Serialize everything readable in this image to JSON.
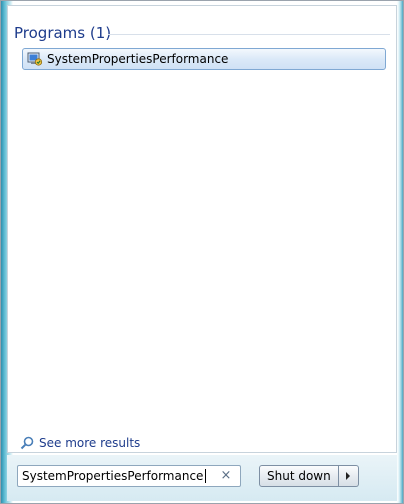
{
  "results": {
    "section_title": "Programs (1)",
    "items": [
      {
        "label": "SystemPropertiesPerformance",
        "icon": "system-properties-icon"
      }
    ]
  },
  "see_more": {
    "label": "See more results",
    "icon": "search-icon"
  },
  "search": {
    "value": "SystemPropertiesPerformance",
    "clear_icon": "×"
  },
  "power": {
    "shutdown_label": "Shut down",
    "arrow_icon": "chevron-right-icon"
  },
  "colors": {
    "header_text": "#1e3c8c",
    "link_text": "#1e3c8c",
    "selection_border": "#7fa8d3"
  }
}
